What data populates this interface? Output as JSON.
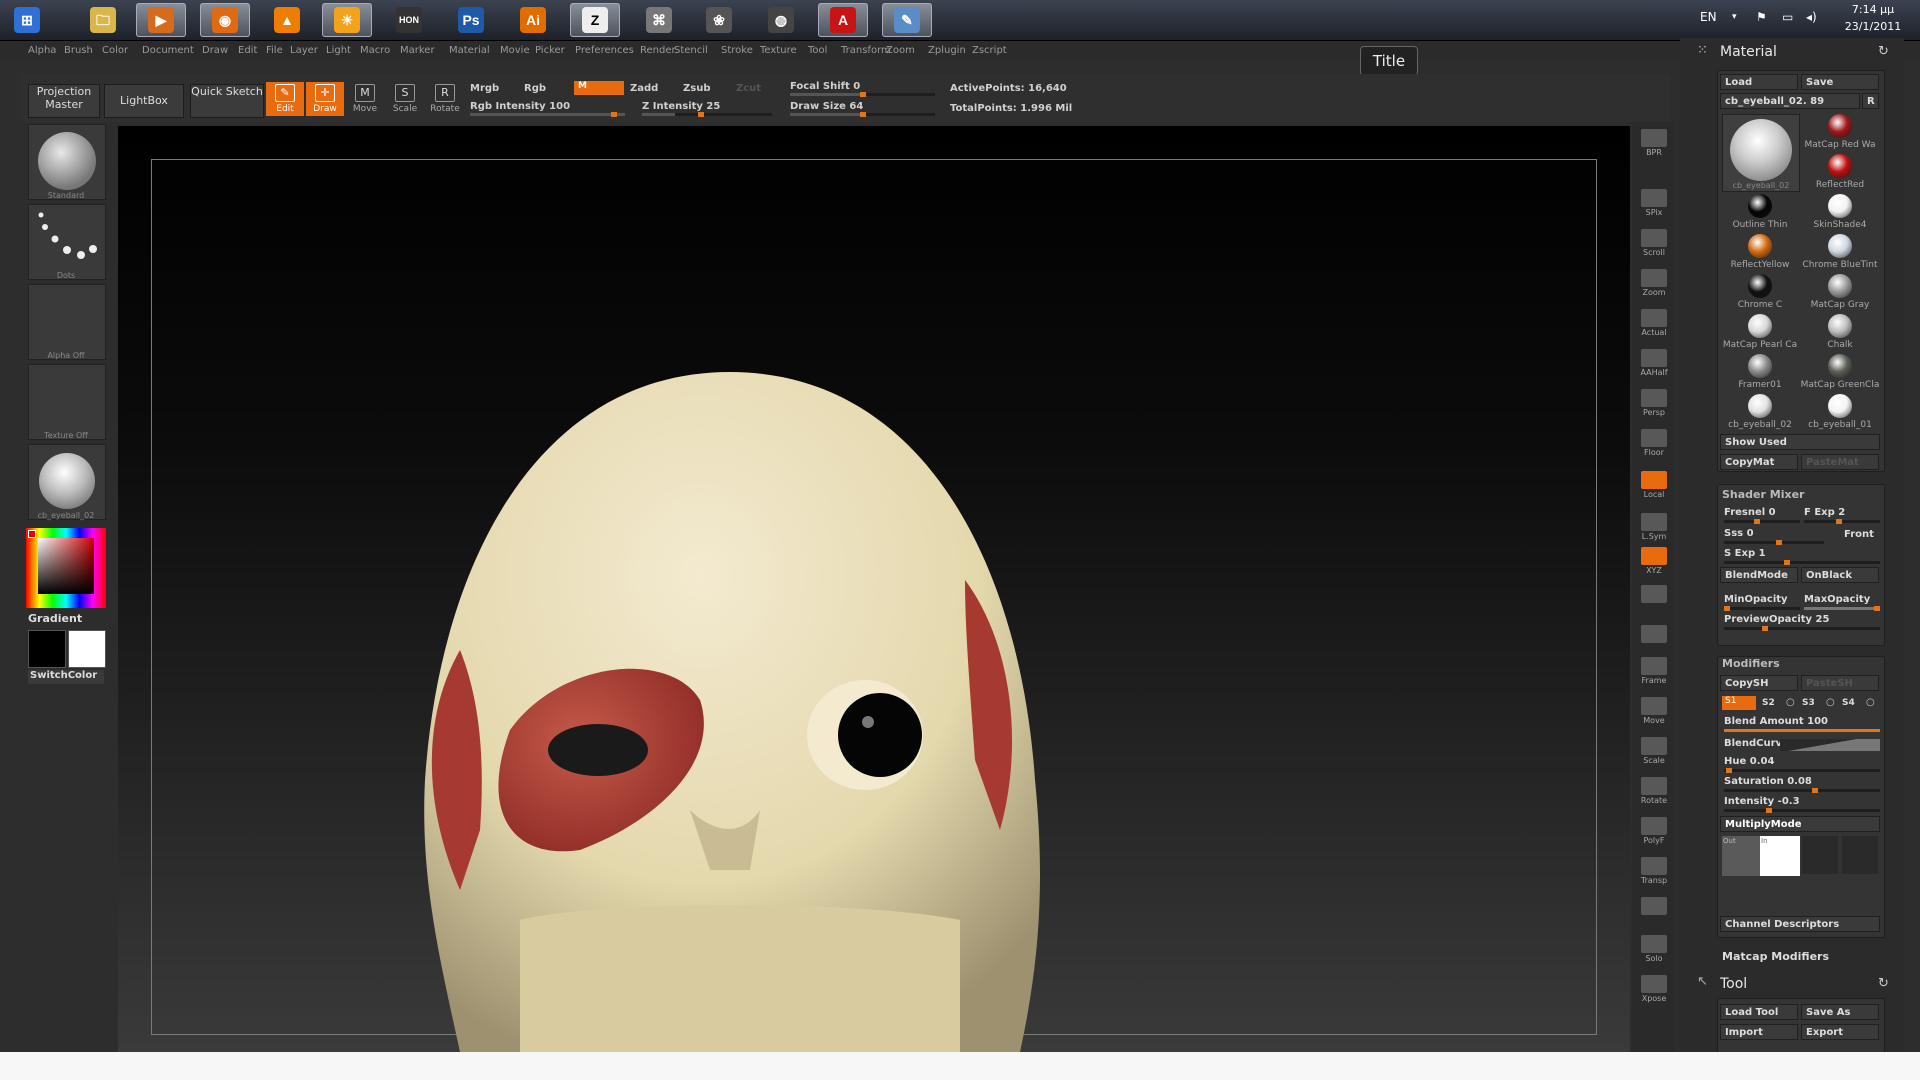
{
  "taskbar": {
    "apps": [
      {
        "name": "start-button",
        "label": "⊞"
      },
      {
        "name": "explorer",
        "label": "🗀"
      },
      {
        "name": "media-player",
        "label": "▶"
      },
      {
        "name": "firefox",
        "label": "◉"
      },
      {
        "name": "vlc",
        "label": "▲"
      },
      {
        "name": "app-sun",
        "label": "☀"
      },
      {
        "name": "hon",
        "label": "HON"
      },
      {
        "name": "photoshop",
        "label": "Ps"
      },
      {
        "name": "illustrator",
        "label": "Ai"
      },
      {
        "name": "zbrush",
        "label": "Z"
      },
      {
        "name": "app-6",
        "label": "⌘"
      },
      {
        "name": "app-7",
        "label": "❀"
      },
      {
        "name": "app-8",
        "label": "◍"
      },
      {
        "name": "acrobat",
        "label": "A"
      },
      {
        "name": "paint",
        "label": "✎"
      }
    ],
    "lang": "EN",
    "time": "7:14 μμ",
    "date": "23/1/2011"
  },
  "menu": [
    "Alpha",
    "Brush",
    "Color",
    "Document",
    "Draw",
    "Edit",
    "File",
    "Layer",
    "Light",
    "Macro",
    "Marker",
    "Material",
    "Movie",
    "Picker",
    "Preferences",
    "Render",
    "Stencil",
    "Stroke",
    "Texture",
    "Tool",
    "Transform",
    "Zoom",
    "Zplugin",
    "Zscript"
  ],
  "title_button": "Title",
  "toolbar": {
    "projection_master": "Projection Master",
    "lightbox": "LightBox",
    "quick_sketch": "Quick Sketch",
    "edit": "Edit",
    "draw": "Draw",
    "move": "Move",
    "scale": "Scale",
    "rotate": "Rotate",
    "mrgb": "Mrgb",
    "rgb": "Rgb",
    "m": "M",
    "zadd": "Zadd",
    "zsub": "Zsub",
    "zcut": "Zcut",
    "rgb_intensity": "Rgb Intensity 100",
    "z_intensity": "Z Intensity 25",
    "focal_shift": "Focal Shift 0",
    "draw_size": "Draw Size 64",
    "active_points": "ActivePoints: 16,640",
    "total_points": "TotalPoints: 1.996 Mil"
  },
  "left_shelf": {
    "brush": "Standard",
    "stroke": "Dots",
    "alpha": "Alpha Off",
    "texture": "Texture Off",
    "material": "cb_eyeball_02",
    "gradient": "Gradient",
    "switch_color": "SwitchColor"
  },
  "right_shelf": [
    "BPR",
    "SPix",
    "Scroll",
    "Zoom",
    "Actual",
    "AAHalf",
    "Persp",
    "Floor",
    "Local",
    "L.Sym",
    "XYZ",
    "",
    "",
    "Frame",
    "Move",
    "Scale",
    "Rotate",
    "PolyF",
    "Transp",
    "",
    "Solo",
    "Xpose"
  ],
  "material_palette": {
    "title": "Material",
    "load": "Load",
    "save": "Save",
    "current": "cb_eyeball_02. 89",
    "r": "R",
    "current_caption": "cb_eyeball_02",
    "materials": [
      {
        "label": "MatCap Red Wa",
        "color": "#a01818"
      },
      {
        "label": "ReflectRed",
        "color": "#c01010"
      },
      {
        "label": "Outline Thin",
        "color": "#050505"
      },
      {
        "label": "SkinShade4",
        "color": "#f2f2f2"
      },
      {
        "label": "ReflectYellow",
        "color": "#d26a10"
      },
      {
        "label": "Chrome BlueTint",
        "color": "#cfd8e0"
      },
      {
        "label": "Chrome C",
        "color": "#111111"
      },
      {
        "label": "MatCap Gray",
        "color": "#9a9a9a"
      },
      {
        "label": "MatCap Pearl Ca",
        "color": "#d8d8d8"
      },
      {
        "label": "Chalk",
        "color": "#bdbdbd"
      },
      {
        "label": "Framer01",
        "color": "#8a8a8a"
      },
      {
        "label": "MatCap GreenCla",
        "color": "#5a5f55"
      },
      {
        "label": "cb_eyeball_02",
        "color": "#e2e2e2"
      },
      {
        "label": "cb_eyeball_01",
        "color": "#f4f4f4"
      }
    ],
    "show_used": "Show Used",
    "copy_mat": "CopyMat",
    "paste_mat": "PasteMat"
  },
  "shader_mixer": {
    "title": "Shader Mixer",
    "fresnel": "Fresnel 0",
    "f_exp": "F Exp 2",
    "sss": "Sss 0",
    "front": "Front",
    "s_exp": "S Exp 1",
    "blend_mode": "BlendMode",
    "on_black": "OnBlack",
    "min_opacity": "MinOpacity",
    "max_opacity": "MaxOpacity",
    "preview_opacity": "PreviewOpacity 25"
  },
  "modifiers": {
    "title": "Modifiers",
    "copy_sh": "CopySH",
    "paste_sh": "PasteSH",
    "s1": "S1",
    "s2": "S2",
    "s3": "S3",
    "s4": "S4",
    "blend_amount": "Blend Amount 100",
    "blend_curve": "BlendCurve",
    "hue": "Hue 0.04",
    "saturation": "Saturation 0.08",
    "intensity": "Intensity -0.3",
    "multiply_mode": "MultiplyMode",
    "out": "Out",
    "in": "In",
    "channel_descriptors": "Channel Descriptors"
  },
  "matcap_modifiers": "Matcap Modifiers",
  "tool_palette": {
    "title": "Tool",
    "load_tool": "Load Tool",
    "save_as": "Save As",
    "import": "Import",
    "export": "Export"
  }
}
